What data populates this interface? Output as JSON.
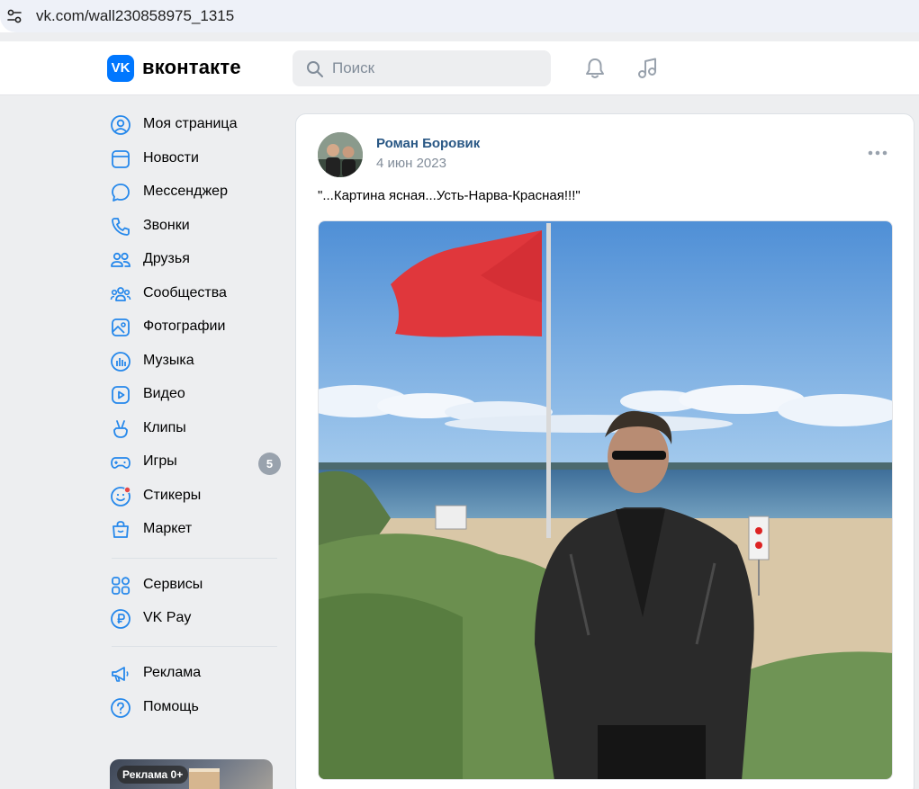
{
  "browser": {
    "url": "vk.com/wall230858975_1315"
  },
  "header": {
    "logo_mark": "VK",
    "logo_text": "вконтакте",
    "search_placeholder": "Поиск"
  },
  "sidebar": {
    "items": [
      {
        "label": "Моя страница",
        "icon": "profile-icon"
      },
      {
        "label": "Новости",
        "icon": "news-icon"
      },
      {
        "label": "Мессенджер",
        "icon": "message-icon"
      },
      {
        "label": "Звонки",
        "icon": "phone-icon"
      },
      {
        "label": "Друзья",
        "icon": "friends-icon"
      },
      {
        "label": "Сообщества",
        "icon": "communities-icon"
      },
      {
        "label": "Фотографии",
        "icon": "photos-icon"
      },
      {
        "label": "Музыка",
        "icon": "music-icon"
      },
      {
        "label": "Видео",
        "icon": "video-icon"
      },
      {
        "label": "Клипы",
        "icon": "clips-icon"
      },
      {
        "label": "Игры",
        "icon": "games-icon",
        "badge": "5"
      },
      {
        "label": "Стикеры",
        "icon": "stickers-icon"
      },
      {
        "label": "Маркет",
        "icon": "market-icon"
      }
    ],
    "services": [
      {
        "label": "Сервисы",
        "icon": "services-icon"
      },
      {
        "label": "VK Pay",
        "icon": "vkpay-icon"
      }
    ],
    "footer": [
      {
        "label": "Реклама",
        "icon": "ads-icon"
      },
      {
        "label": "Помощь",
        "icon": "help-icon"
      }
    ],
    "ad_label": "Реклама 0+"
  },
  "post": {
    "author": "Роман Боровик",
    "date": "4 июн 2023",
    "text": "\"...Картина ясная...Усть-Нарва-Красная!!!\""
  },
  "colors": {
    "accent": "#0077ff",
    "link": "#2a5885",
    "secondary": "#818c99",
    "background": "#edeef0"
  }
}
